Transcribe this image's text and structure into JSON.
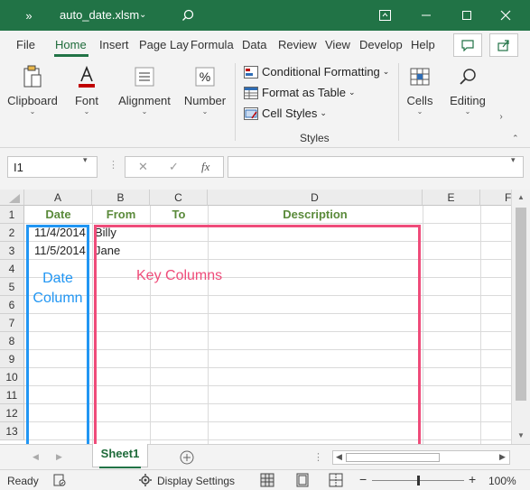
{
  "titlebar": {
    "qat_more": "»",
    "file_name": "auto_date.xlsm",
    "file_caret": "⌄"
  },
  "tabs": [
    {
      "label": "File"
    },
    {
      "label": "Home",
      "active": true
    },
    {
      "label": "Insert"
    },
    {
      "label": "Page Lay"
    },
    {
      "label": "Formula"
    },
    {
      "label": "Data"
    },
    {
      "label": "Review"
    },
    {
      "label": "View"
    },
    {
      "label": "Develop"
    },
    {
      "label": "Help"
    }
  ],
  "ribbon": {
    "clipboard": "Clipboard",
    "font": "Font",
    "alignment": "Alignment",
    "number": "Number",
    "conditional_formatting": "Conditional Formatting",
    "format_as_table": "Format as Table",
    "cell_styles": "Cell Styles",
    "styles_group": "Styles",
    "cells": "Cells",
    "editing": "Editing",
    "caret": "⌄"
  },
  "formula_bar": {
    "name_box": "I1",
    "fx": "fx",
    "cancel": "✕",
    "enter": "✓",
    "formula": ""
  },
  "grid": {
    "columns": [
      "A",
      "B",
      "C",
      "D",
      "E",
      "F"
    ],
    "rows": [
      "1",
      "2",
      "3",
      "4",
      "5",
      "6",
      "7",
      "8",
      "9",
      "10",
      "11",
      "12",
      "13"
    ],
    "headers": {
      "a1": "Date",
      "b1": "From",
      "c1": "To",
      "d1": "Description"
    },
    "data": [
      {
        "date": "11/4/2014",
        "from": "Billy"
      },
      {
        "date": "11/5/2014",
        "from": "Jane"
      }
    ],
    "annotations": {
      "date_column": "Date Column",
      "key_columns": "Key Columns"
    }
  },
  "sheets": [
    {
      "label": "Sheet1",
      "active": true
    }
  ],
  "status": {
    "ready": "Ready",
    "display_settings": "Display Settings",
    "zoom": "100%",
    "zoom_minus": "−",
    "zoom_plus": "+"
  },
  "colors": {
    "excel_green": "#217346",
    "header_text_green": "#5a8a3a",
    "date_box_blue": "#2196f3",
    "key_box_pink": "#ef4c7a"
  }
}
